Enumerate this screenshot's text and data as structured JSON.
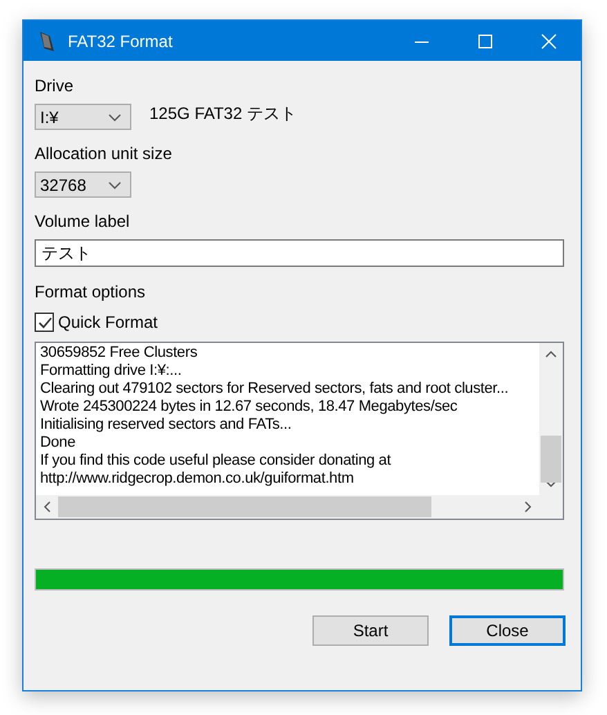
{
  "window": {
    "title": "FAT32 Format"
  },
  "drive": {
    "label": "Drive",
    "value": "I:¥",
    "info": "125G FAT32 テスト"
  },
  "allocation": {
    "label": "Allocation unit size",
    "value": "32768"
  },
  "volume": {
    "label": "Volume label",
    "value": "テスト"
  },
  "options": {
    "label": "Format options",
    "quick_format": {
      "label": "Quick Format",
      "checked": true
    }
  },
  "log": [
    "30659852 Free Clusters",
    "Formatting drive I:¥:...",
    "Clearing out 479102 sectors for Reserved sectors, fats and root cluster...",
    "Wrote 245300224 bytes in 12.67 seconds, 18.47 Megabytes/sec",
    "Initialising reserved sectors and FATs...",
    "Done",
    "If you find this code useful please consider donating at",
    "http://www.ridgecrop.demon.co.uk/guiformat.htm"
  ],
  "progress": {
    "level": 1
  },
  "buttons": [
    {
      "label": "Start",
      "focused": false
    },
    {
      "label": "Close",
      "focused": true
    }
  ]
}
